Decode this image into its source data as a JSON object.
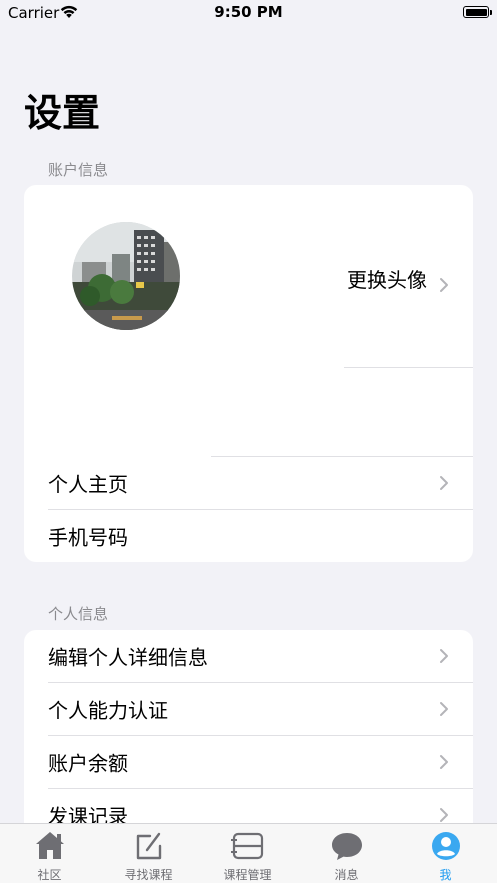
{
  "status_bar": {
    "carrier": "Carrier",
    "time": "9:50 PM"
  },
  "page_title": "设置",
  "account_section": {
    "header": "账户信息",
    "change_avatar_label": "更换头像",
    "rows": [
      {
        "label": "个人主页"
      },
      {
        "label": "手机号码"
      }
    ]
  },
  "personal_section": {
    "header": "个人信息",
    "rows": [
      {
        "label": "编辑个人详细信息"
      },
      {
        "label": "个人能力认证"
      },
      {
        "label": "账户余额"
      },
      {
        "label": "发课记录"
      }
    ]
  },
  "tab_bar": {
    "active_index": 4,
    "active_color": "#1e9bf0",
    "tabs": [
      {
        "label": "社区",
        "icon": "home-icon"
      },
      {
        "label": "寻找课程",
        "icon": "edit-icon"
      },
      {
        "label": "课程管理",
        "icon": "list-icon"
      },
      {
        "label": "消息",
        "icon": "chat-bubble-icon"
      },
      {
        "label": "我",
        "icon": "person-icon"
      }
    ]
  }
}
